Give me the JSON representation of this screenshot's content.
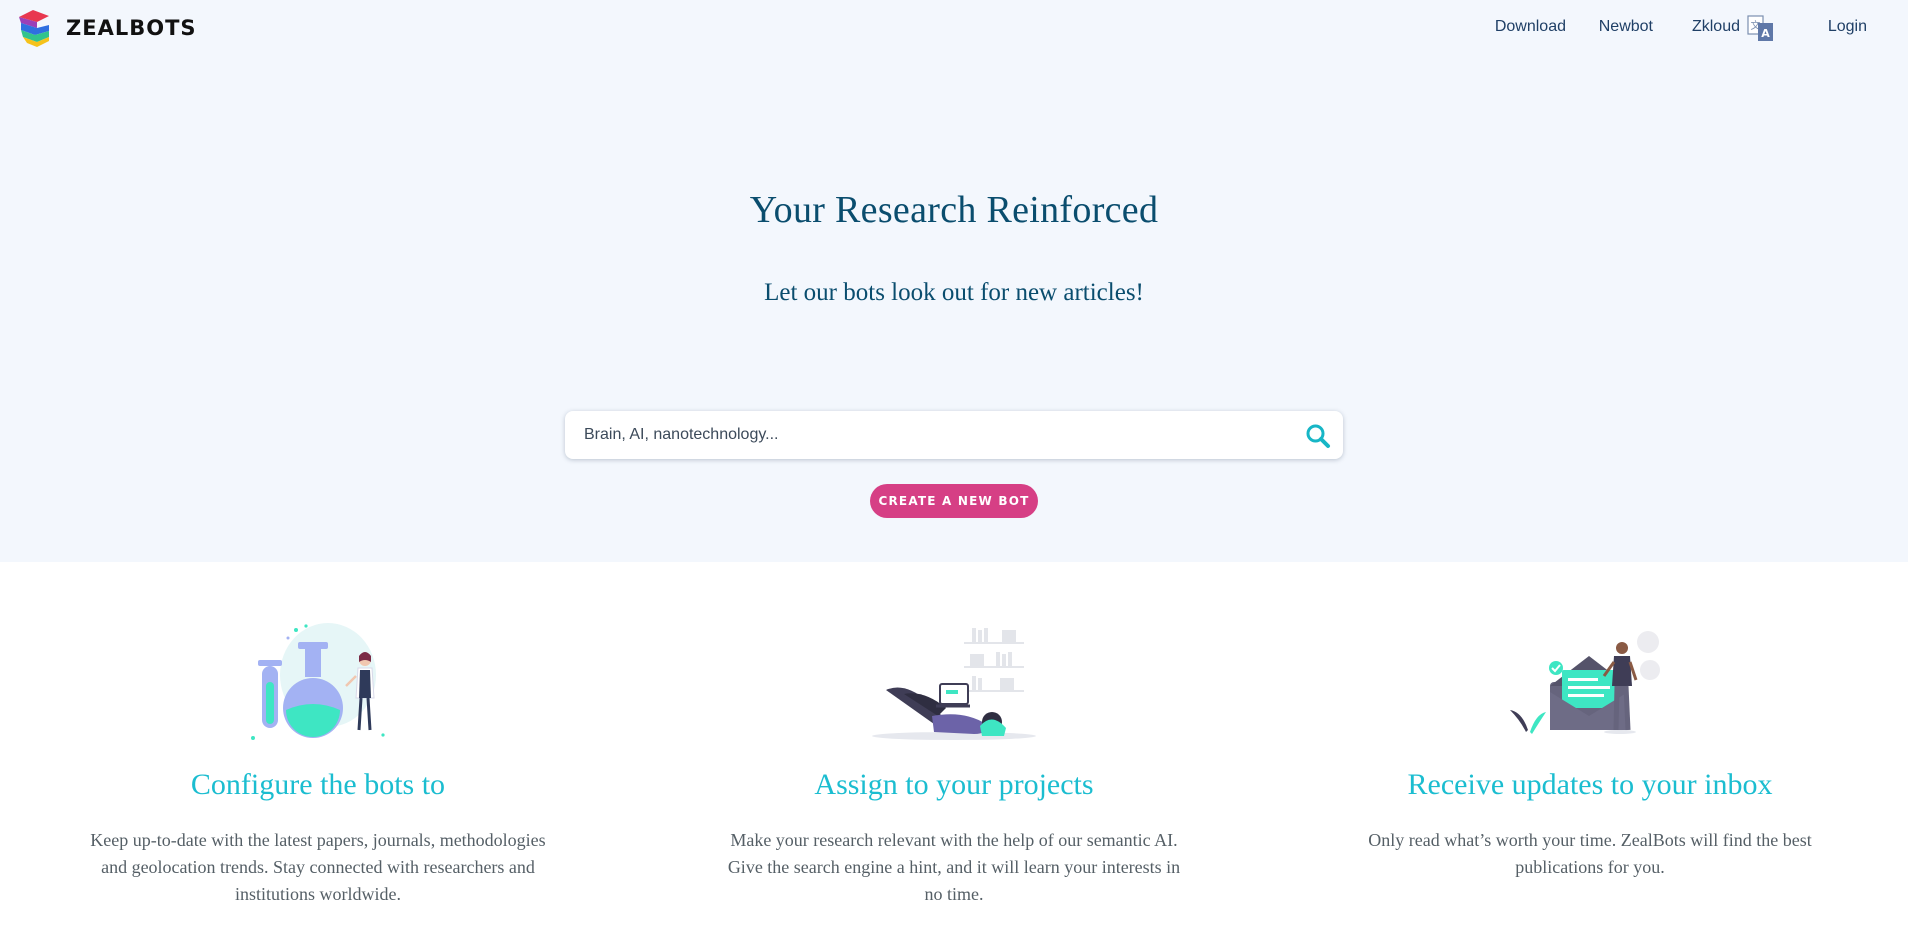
{
  "brand": {
    "name": "ZEALBOTS"
  },
  "nav": {
    "download": "Download",
    "newbot": "Newbot",
    "zkloud": "Zkloud",
    "language_icon": "translate-icon",
    "login": "Login"
  },
  "hero": {
    "title": "Your Research Reinforced",
    "subtitle": "Let our bots look out for new articles!"
  },
  "search": {
    "placeholder": "Brain, AI, nanotechnology...",
    "value": "",
    "icon": "search-icon"
  },
  "create_button": {
    "label": "CREATE A NEW BOT"
  },
  "features": [
    {
      "title": "Configure the bots to",
      "description": "Keep up-to-date with the latest papers, journals, methodologies and geolocation trends. Stay connected with researchers and institutions worldwide.",
      "icon": "lab-scientist-illustration"
    },
    {
      "title": "Assign to your projects",
      "description": "Make your research relevant with the help of our semantic AI. Give the search engine a hint, and it will learn your interests in no time.",
      "icon": "reading-laptop-illustration"
    },
    {
      "title": "Receive updates to your inbox",
      "description": "Only read what’s worth your time. ZealBots will find the best publications for you.",
      "icon": "mail-envelope-illustration"
    }
  ],
  "colors": {
    "hero_background": "#f3f7fd",
    "nav_text": "#1f3f66",
    "heading": "#0a4d6e",
    "accent_cyan": "#1bbdd0",
    "button_pink": "#d63f85",
    "illustration_mint": "#3ee6c3",
    "illustration_lavender": "#a3b2f3"
  }
}
